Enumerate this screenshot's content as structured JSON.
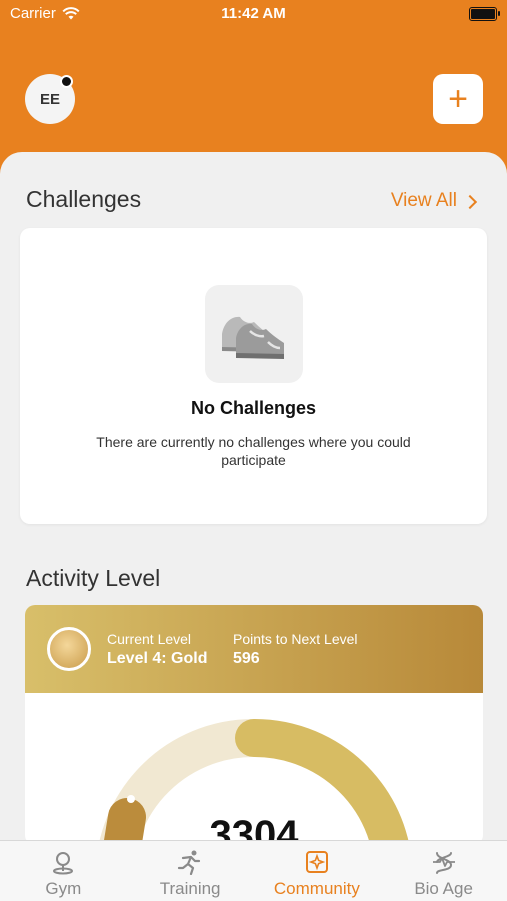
{
  "status": {
    "carrier": "Carrier",
    "time": "11:42 AM"
  },
  "header": {
    "avatar_initials": "EE",
    "add_label": "+"
  },
  "challenges": {
    "title": "Challenges",
    "view_all": "View All",
    "empty_title": "No Challenges",
    "empty_desc": "There are currently no challenges where you could participate"
  },
  "activity": {
    "title": "Activity Level",
    "current_level_label": "Current Level",
    "current_level_value": "Level 4: Gold",
    "points_label": "Points to Next Level",
    "points_value": "596",
    "total_points": "3304"
  },
  "tabs": [
    {
      "label": "Gym",
      "icon": "location-pin-icon"
    },
    {
      "label": "Training",
      "icon": "running-person-icon"
    },
    {
      "label": "Community",
      "icon": "community-icon"
    },
    {
      "label": "Bio Age",
      "icon": "bio-age-icon"
    }
  ],
  "colors": {
    "accent": "#e8811f",
    "gold_start": "#d8bf6a",
    "gold_end": "#b88939"
  }
}
